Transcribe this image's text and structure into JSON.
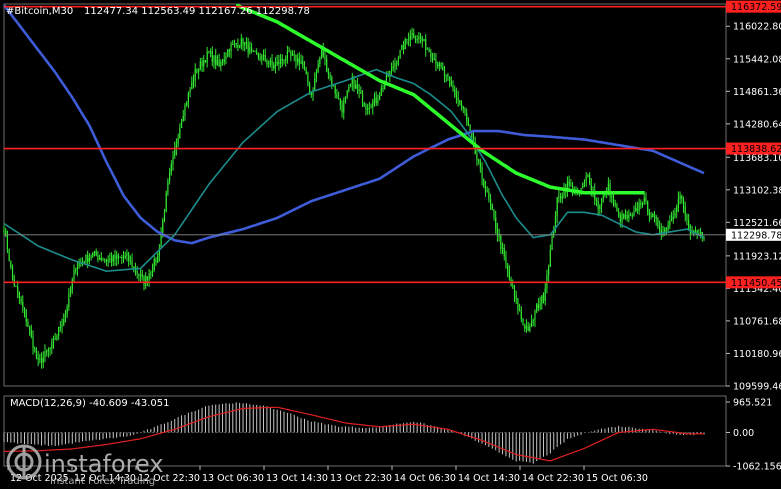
{
  "header": {
    "symbol": "#Bitcoin,M30",
    "ohlc": "112477.34 112563.49 112167.26 112298.78"
  },
  "chart_data": {
    "type": "candlestick",
    "y_ticks": [
      "116022.80",
      "115442.08",
      "114861.36",
      "114280.64",
      "113683.10",
      "113102.38",
      "112521.66",
      "111923.12",
      "111342.40",
      "110761.68",
      "110180.96",
      "109599.46"
    ],
    "y_range": [
      109599.46,
      116420
    ],
    "x_ticks": [
      "12 Oct 2025",
      "12 Oct 14:30",
      "12 Oct 22:30",
      "13 Oct 06:30",
      "13 Oct 14:30",
      "13 Oct 22:30",
      "14 Oct 06:30",
      "14 Oct 14:30",
      "14 Oct 22:30",
      "15 Oct 06:30"
    ],
    "levels": [
      {
        "label": "116372.59",
        "value": 116372.59,
        "color": "#ff2020"
      },
      {
        "label": "113838.62",
        "value": 113838.62,
        "color": "#ff2020"
      },
      {
        "label": "111450.45",
        "value": 111450.45,
        "color": "#ff2020"
      }
    ],
    "current_price": {
      "label": "112298.78",
      "value": 112298.78
    },
    "close_anchors": [
      [
        0,
        112450
      ],
      [
        5,
        111500
      ],
      [
        12,
        110900
      ],
      [
        20,
        110000
      ],
      [
        28,
        110300
      ],
      [
        36,
        110900
      ],
      [
        42,
        111750
      ],
      [
        52,
        111950
      ],
      [
        60,
        111850
      ],
      [
        72,
        111900
      ],
      [
        82,
        111450
      ],
      [
        90,
        111900
      ],
      [
        96,
        113200
      ],
      [
        104,
        114400
      ],
      [
        112,
        115200
      ],
      [
        120,
        115550
      ],
      [
        126,
        115300
      ],
      [
        132,
        115650
      ],
      [
        140,
        115750
      ],
      [
        146,
        115500
      ],
      [
        152,
        115450
      ],
      [
        158,
        115300
      ],
      [
        166,
        115500
      ],
      [
        174,
        115400
      ],
      [
        180,
        114800
      ],
      [
        186,
        115600
      ],
      [
        192,
        115000
      ],
      [
        198,
        114550
      ],
      [
        204,
        115050
      ],
      [
        212,
        114600
      ],
      [
        218,
        114700
      ],
      [
        226,
        115200
      ],
      [
        232,
        115550
      ],
      [
        238,
        115900
      ],
      [
        244,
        115800
      ],
      [
        250,
        115550
      ],
      [
        256,
        115250
      ],
      [
        262,
        114950
      ],
      [
        270,
        114450
      ],
      [
        276,
        113750
      ],
      [
        284,
        112900
      ],
      [
        292,
        112000
      ],
      [
        296,
        111500
      ],
      [
        300,
        111100
      ],
      [
        304,
        110700
      ],
      [
        308,
        110600
      ],
      [
        312,
        111000
      ],
      [
        316,
        111200
      ],
      [
        320,
        112000
      ],
      [
        324,
        112900
      ],
      [
        330,
        113200
      ],
      [
        336,
        113000
      ],
      [
        342,
        113350
      ],
      [
        348,
        112800
      ],
      [
        354,
        113150
      ],
      [
        360,
        112600
      ],
      [
        368,
        112600
      ],
      [
        374,
        112950
      ],
      [
        380,
        112600
      ],
      [
        386,
        112350
      ],
      [
        390,
        112550
      ],
      [
        396,
        113000
      ],
      [
        402,
        112300
      ],
      [
        410,
        112300
      ]
    ],
    "sma_fast_anchors": [
      [
        0,
        112500
      ],
      [
        20,
        112100
      ],
      [
        40,
        111850
      ],
      [
        60,
        111650
      ],
      [
        80,
        111700
      ],
      [
        100,
        112300
      ],
      [
        120,
        113200
      ],
      [
        140,
        113950
      ],
      [
        160,
        114500
      ],
      [
        180,
        114850
      ],
      [
        200,
        115050
      ],
      [
        218,
        115250
      ],
      [
        230,
        115100
      ],
      [
        240,
        115000
      ],
      [
        250,
        114800
      ],
      [
        262,
        114500
      ],
      [
        272,
        114100
      ],
      [
        282,
        113600
      ],
      [
        292,
        113000
      ],
      [
        300,
        112600
      ],
      [
        310,
        112250
      ],
      [
        320,
        112300
      ],
      [
        330,
        112700
      ],
      [
        340,
        112700
      ],
      [
        350,
        112650
      ],
      [
        360,
        112500
      ],
      [
        370,
        112350
      ],
      [
        380,
        112300
      ],
      [
        390,
        112350
      ],
      [
        400,
        112400
      ],
      [
        410,
        112250
      ]
    ],
    "sma_slow_anchors": [
      [
        0,
        116400
      ],
      [
        10,
        116000
      ],
      [
        20,
        115600
      ],
      [
        30,
        115200
      ],
      [
        40,
        114750
      ],
      [
        50,
        114250
      ],
      [
        60,
        113600
      ],
      [
        70,
        113000
      ],
      [
        80,
        112600
      ],
      [
        90,
        112350
      ],
      [
        100,
        112200
      ],
      [
        110,
        112150
      ],
      [
        120,
        112250
      ],
      [
        140,
        112400
      ],
      [
        160,
        112600
      ],
      [
        180,
        112900
      ],
      [
        200,
        113100
      ],
      [
        220,
        113300
      ],
      [
        240,
        113700
      ],
      [
        260,
        114000
      ],
      [
        275,
        114150
      ],
      [
        290,
        114150
      ],
      [
        305,
        114080
      ],
      [
        320,
        114050
      ],
      [
        340,
        114000
      ],
      [
        360,
        113900
      ],
      [
        380,
        113800
      ],
      [
        395,
        113600
      ],
      [
        410,
        113400
      ]
    ],
    "sma_trend_anchors": [
      [
        136,
        116400
      ],
      [
        160,
        116100
      ],
      [
        180,
        115750
      ],
      [
        200,
        115400
      ],
      [
        220,
        115050
      ],
      [
        240,
        114800
      ],
      [
        260,
        114300
      ],
      [
        280,
        113800
      ],
      [
        300,
        113400
      ],
      [
        320,
        113150
      ],
      [
        340,
        113050
      ],
      [
        360,
        113050
      ],
      [
        375,
        113050
      ]
    ],
    "macd": {
      "label": "MACD(12,26,9) -40.609 -43.051",
      "y_ticks": [
        "965.521",
        "0.00",
        "-1062.156"
      ],
      "y_range": [
        -1062.156,
        965.521
      ],
      "hist_anchors": [
        [
          0,
          -300
        ],
        [
          15,
          -380
        ],
        [
          30,
          -420
        ],
        [
          45,
          -300
        ],
        [
          60,
          -200
        ],
        [
          75,
          -100
        ],
        [
          90,
          200
        ],
        [
          105,
          550
        ],
        [
          120,
          870
        ],
        [
          135,
          940
        ],
        [
          150,
          870
        ],
        [
          165,
          650
        ],
        [
          180,
          350
        ],
        [
          195,
          200
        ],
        [
          215,
          140
        ],
        [
          225,
          230
        ],
        [
          240,
          350
        ],
        [
          255,
          160
        ],
        [
          270,
          -100
        ],
        [
          285,
          -500
        ],
        [
          300,
          -900
        ],
        [
          310,
          -980
        ],
        [
          320,
          -650
        ],
        [
          330,
          -220
        ],
        [
          345,
          70
        ],
        [
          360,
          200
        ],
        [
          375,
          120
        ],
        [
          390,
          -40
        ],
        [
          402,
          -80
        ],
        [
          410,
          -50
        ]
      ],
      "signal_anchors": [
        [
          0,
          -600
        ],
        [
          20,
          -580
        ],
        [
          40,
          -520
        ],
        [
          60,
          -380
        ],
        [
          80,
          -200
        ],
        [
          100,
          100
        ],
        [
          120,
          500
        ],
        [
          140,
          760
        ],
        [
          160,
          800
        ],
        [
          180,
          560
        ],
        [
          200,
          300
        ],
        [
          220,
          180
        ],
        [
          240,
          260
        ],
        [
          260,
          100
        ],
        [
          280,
          -250
        ],
        [
          300,
          -700
        ],
        [
          320,
          -900
        ],
        [
          340,
          -500
        ],
        [
          360,
          0
        ],
        [
          380,
          100
        ],
        [
          400,
          -40
        ],
        [
          410,
          -45
        ]
      ]
    }
  },
  "watermark": {
    "brand": "instaforex",
    "tagline": "Instant Forex Trading"
  },
  "colors": {
    "candle": "#32e632",
    "sma_slow": "#3f5cd8",
    "sma_fast": "#1c8c8c",
    "sma_trend": "#2dff2d",
    "level": "#ff2020",
    "macd_hist": "#c8c8c8",
    "macd_signal": "#e02020"
  }
}
